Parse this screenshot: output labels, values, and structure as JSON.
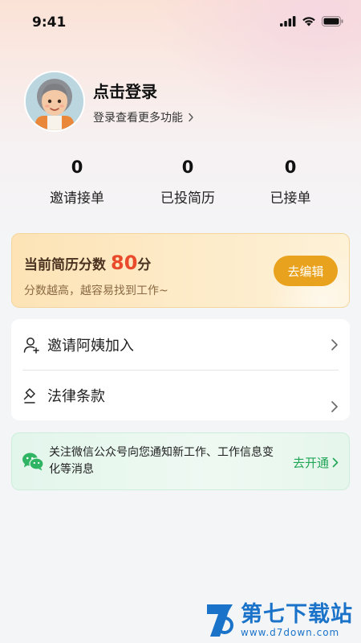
{
  "status_bar": {
    "time": "9:41",
    "icons": [
      "signal-icon",
      "wifi-icon",
      "battery-icon"
    ]
  },
  "profile": {
    "avatar_icon": "user-avatar",
    "title": "点击登录",
    "subtitle": "登录查看更多功能"
  },
  "stats": [
    {
      "value": "0",
      "label": "邀请接单"
    },
    {
      "value": "0",
      "label": "已投简历"
    },
    {
      "value": "0",
      "label": "已接单"
    }
  ],
  "resume": {
    "title": "当前简历分数",
    "score": "80",
    "unit": "分",
    "hint": "分数越高，越容易找到工作~",
    "edit_label": "去编辑",
    "accent": "#e9a21d",
    "score_color": "#e94a2c"
  },
  "menu": {
    "items": [
      {
        "label": "邀请阿姨加入",
        "icon": "user-add-icon"
      },
      {
        "label": "法律条款",
        "icon": "gavel-icon"
      }
    ]
  },
  "wechat_banner": {
    "icon": "wechat-icon",
    "text": "关注微信公众号向您通知新工作、工作信息变化等消息",
    "link_label": "去开通",
    "accent": "#21a557"
  },
  "watermark": {
    "title": "第七下载站",
    "url": "www.d7down.com"
  }
}
